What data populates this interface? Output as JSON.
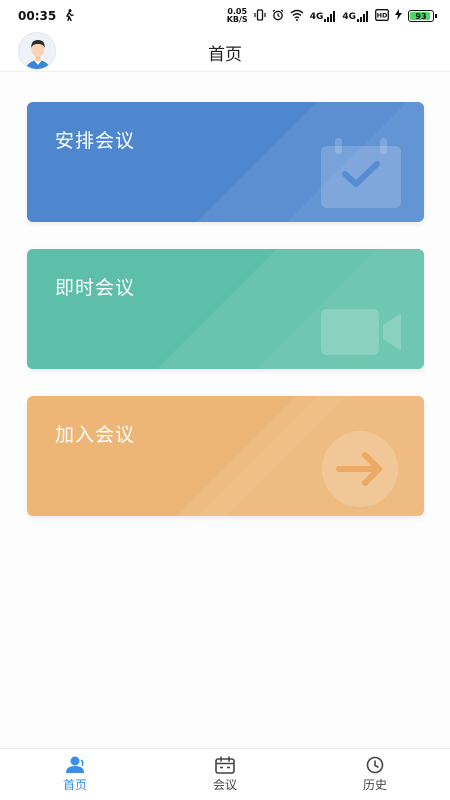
{
  "status_bar": {
    "time": "00:35",
    "net_speed_value": "0.05",
    "net_speed_unit": "KB/S",
    "signal1_label": "4G",
    "signal2_label": "4G",
    "battery_level": "93"
  },
  "header": {
    "title": "首页"
  },
  "cards": [
    {
      "label": "安排会议",
      "icon": "calendar-check-icon",
      "color": "#4f87cf"
    },
    {
      "label": "即时会议",
      "icon": "video-camera-icon",
      "color": "#5dbfa9"
    },
    {
      "label": "加入会议",
      "icon": "arrow-right-circle-icon",
      "color": "#edb676"
    }
  ],
  "tabbar": {
    "active_color": "#3a8ee6",
    "tabs": [
      {
        "label": "首页",
        "icon": "home-user-icon",
        "active": true
      },
      {
        "label": "会议",
        "icon": "calendar-icon",
        "active": false
      },
      {
        "label": "历史",
        "icon": "clock-icon",
        "active": false
      }
    ]
  }
}
